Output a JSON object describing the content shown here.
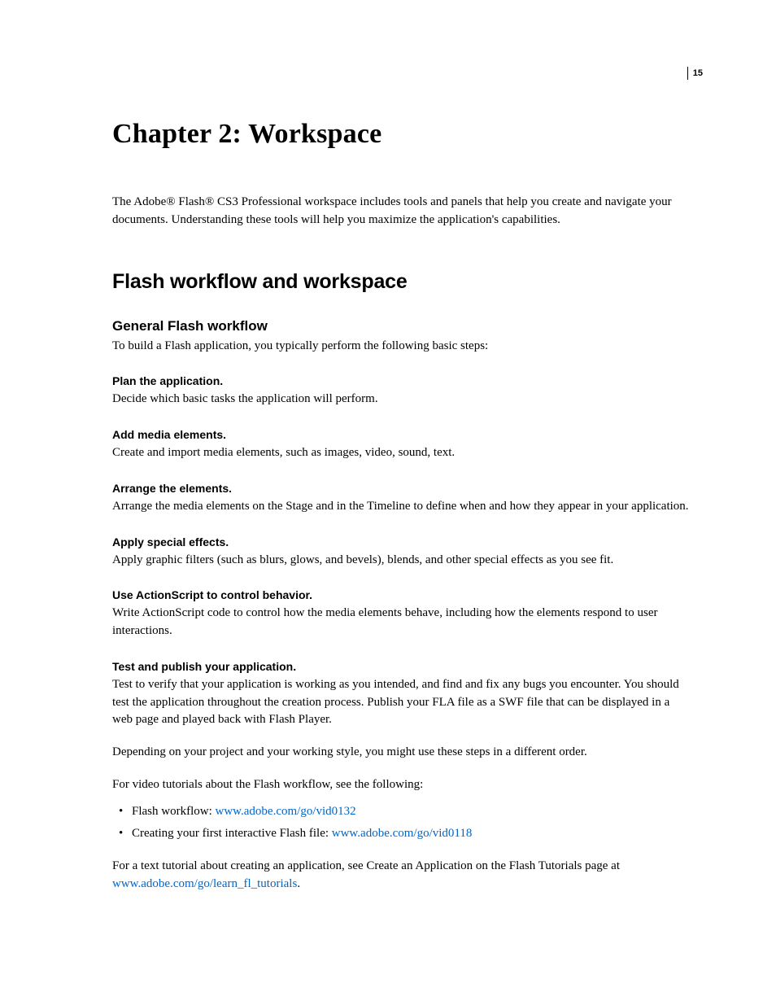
{
  "page_number": "15",
  "chapter_title": "Chapter 2: Workspace",
  "intro": "The Adobe® Flash® CS3 Professional workspace includes tools and panels that help you create and navigate your documents. Understanding these tools will help you maximize the application's capabilities.",
  "section_heading": "Flash workflow and workspace",
  "subsection_heading": "General Flash workflow",
  "subsection_intro": "To build a Flash application, you typically perform the following basic steps:",
  "steps": [
    {
      "title": "Plan the application.",
      "body": "Decide which basic tasks the application will perform."
    },
    {
      "title": "Add media elements.",
      "body": "Create and import media elements, such as images, video, sound, text."
    },
    {
      "title": "Arrange the elements.",
      "body": "Arrange the media elements on the Stage and in the Timeline to define when and how they appear in your application."
    },
    {
      "title": "Apply special effects.",
      "body": "Apply graphic filters (such as blurs, glows, and bevels), blends, and other special effects as you see fit."
    },
    {
      "title": "Use ActionScript to control behavior.",
      "body": "Write ActionScript code to control how the media elements behave, including how the elements respond to user interactions."
    },
    {
      "title": "Test and publish your application.",
      "body": "Test to verify that your application is working as you intended, and find and fix any bugs you encounter. You should test the application throughout the creation process. Publish your FLA file as a SWF file that can be displayed in a web page and played back with Flash Player."
    }
  ],
  "depending_para": "Depending on your project and your working style, you might use these steps in a different order.",
  "video_intro": "For video tutorials about the Flash workflow, see the following:",
  "bullets": {
    "b1_prefix": "Flash workflow: ",
    "b1_link": "www.adobe.com/go/vid0132",
    "b2_prefix": "Creating your first interactive Flash file: ",
    "b2_link": "www.adobe.com/go/vid0118"
  },
  "text_tutorial_prefix": "For a text tutorial about creating an application, see Create an Application on the Flash Tutorials page at ",
  "text_tutorial_link": "www.adobe.com/go/learn_fl_tutorials",
  "text_tutorial_suffix": "."
}
